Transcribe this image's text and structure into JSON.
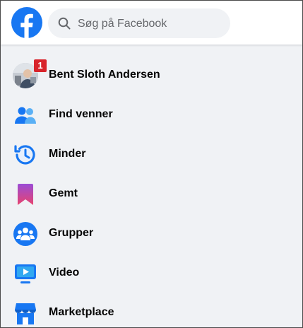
{
  "header": {
    "search": {
      "placeholder": "Søg på Facebook",
      "value": ""
    }
  },
  "menu": {
    "items": [
      {
        "label": "Bent Sloth Andersen",
        "icon": "profile-avatar",
        "badge": "1"
      },
      {
        "label": "Find venner",
        "icon": "friends-icon"
      },
      {
        "label": "Minder",
        "icon": "memories-icon"
      },
      {
        "label": "Gemt",
        "icon": "saved-icon"
      },
      {
        "label": "Grupper",
        "icon": "groups-icon"
      },
      {
        "label": "Video",
        "icon": "video-icon"
      },
      {
        "label": "Marketplace",
        "icon": "marketplace-icon"
      }
    ]
  },
  "colors": {
    "brand": "#1877f2",
    "badge": "#d8242b",
    "background": "#f0f2f5"
  }
}
